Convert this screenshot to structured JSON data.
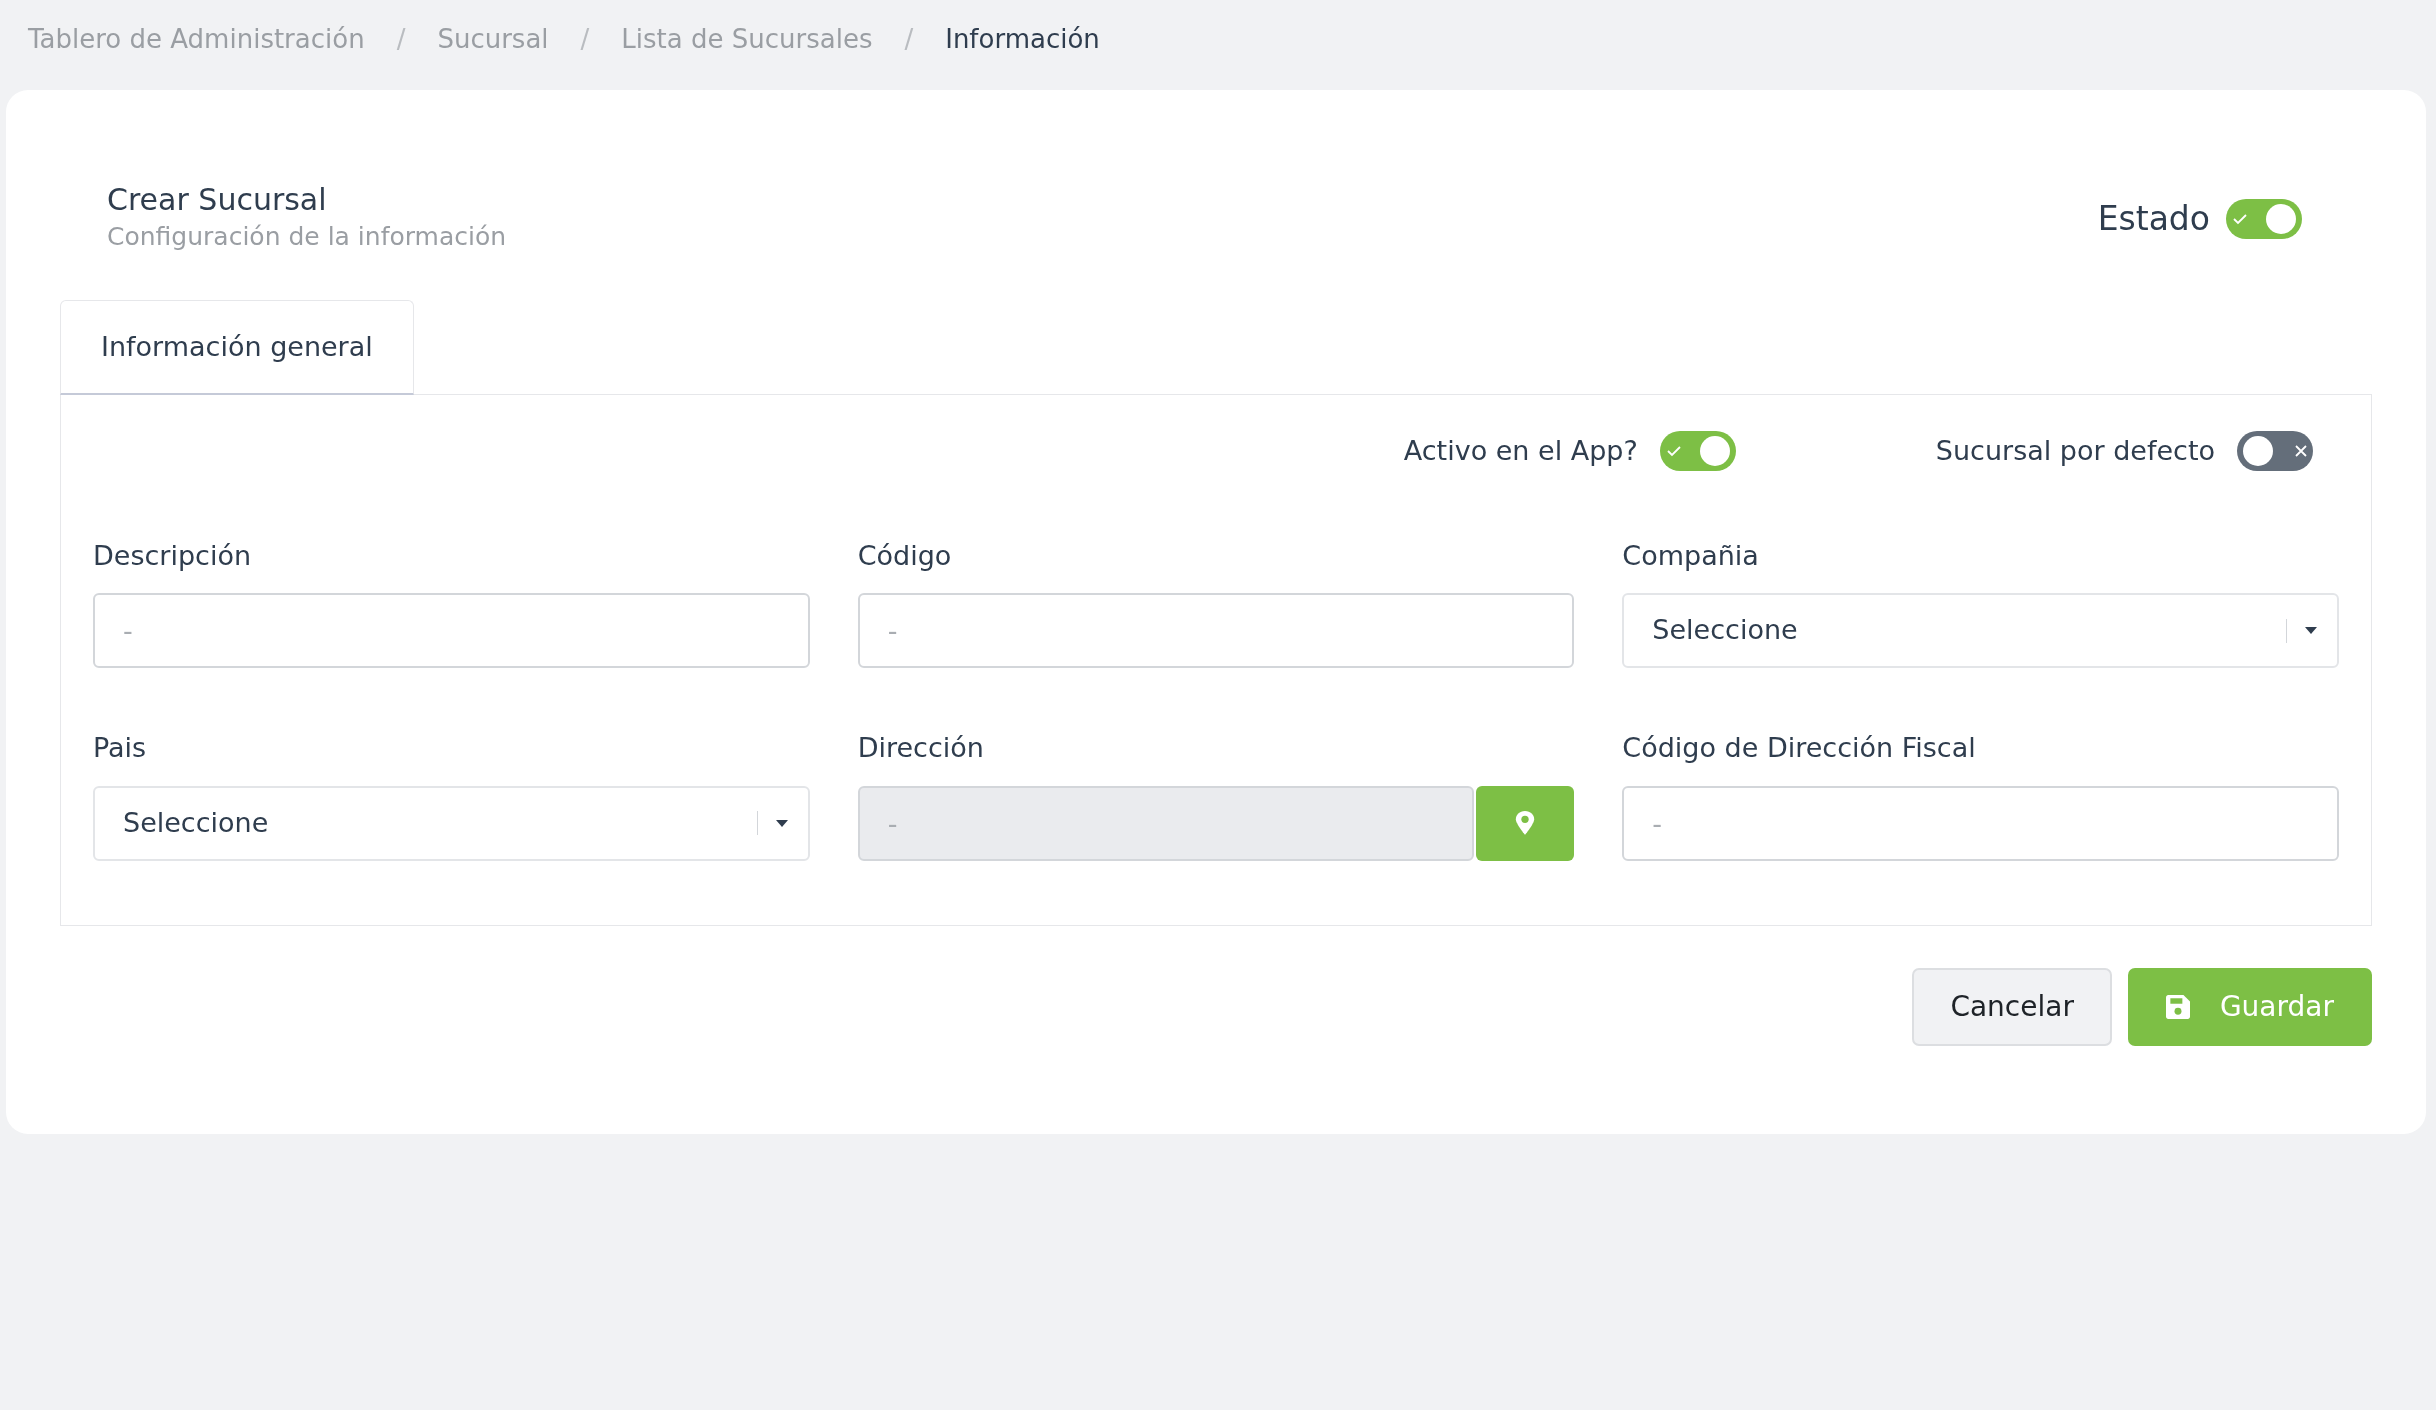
{
  "breadcrumb_separator": "/",
  "breadcrumb": [
    {
      "label": "Tablero de Administración",
      "active": false
    },
    {
      "label": "Sucursal",
      "active": false
    },
    {
      "label": "Lista de Sucursales",
      "active": false
    },
    {
      "label": "Información",
      "active": true
    }
  ],
  "header": {
    "title": "Crear Sucursal",
    "subtitle": "Configuración de la información",
    "status": {
      "label": "Estado",
      "on": true
    }
  },
  "tabs": [
    {
      "label": "Información general",
      "selected": true
    }
  ],
  "switches": [
    {
      "label": "Activo en el App?",
      "on": true
    },
    {
      "label": "Sucursal por defecto",
      "on": false
    }
  ],
  "fields": [
    {
      "kind": "text",
      "label": "Descripción",
      "placeholder": "-",
      "disabled": false
    },
    {
      "kind": "text",
      "label": "Código",
      "placeholder": "-",
      "disabled": false
    },
    {
      "kind": "select",
      "label": "Compañia",
      "value": "Seleccione",
      "disabled": false
    },
    {
      "kind": "select",
      "label": "Pais",
      "value": "Seleccione",
      "disabled": false
    },
    {
      "kind": "location",
      "label": "Dirección",
      "placeholder": "-",
      "disabled": true
    },
    {
      "kind": "text",
      "label": "Código de Dirección Fiscal",
      "placeholder": "-",
      "disabled": false
    }
  ],
  "buttons": [
    {
      "kind": "secondary",
      "label": "Cancelar"
    },
    {
      "kind": "primary",
      "label": "Guardar"
    }
  ]
}
